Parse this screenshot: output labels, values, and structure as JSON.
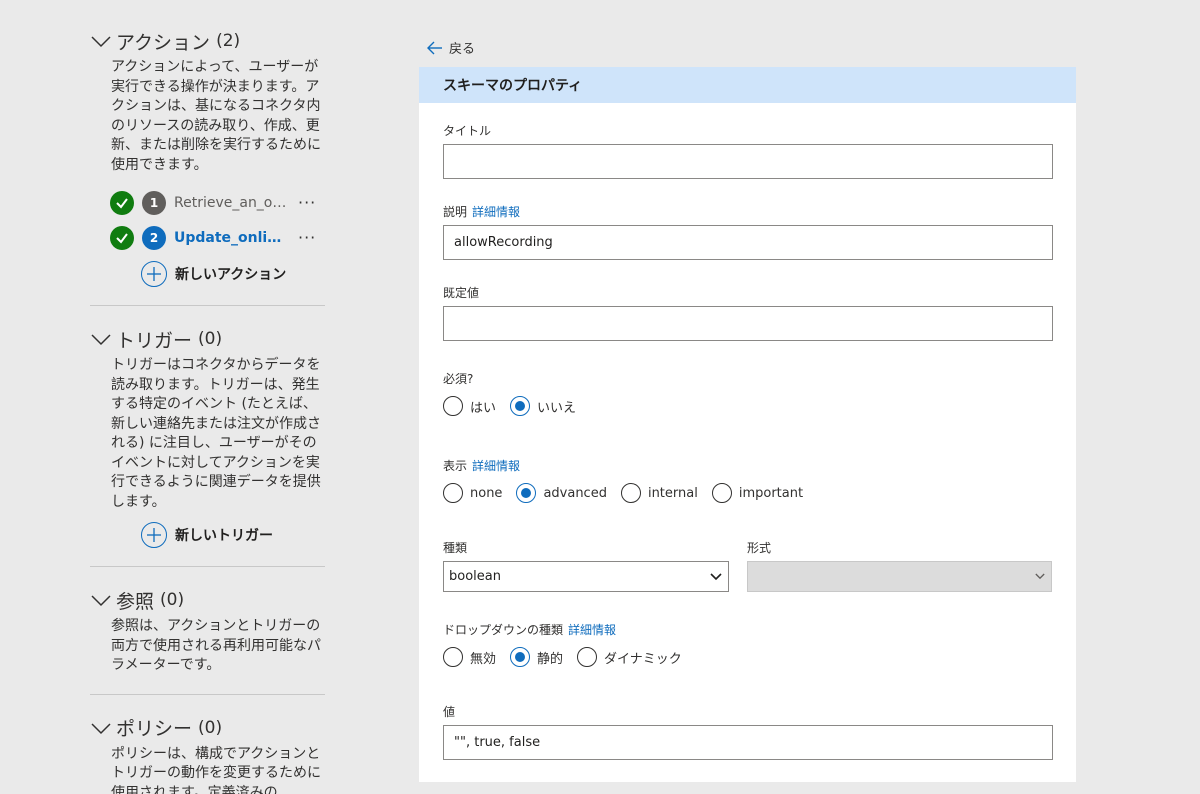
{
  "sidebar": {
    "sections": [
      {
        "title": "アクション",
        "count": "(2)",
        "description": "アクションによって、ユーザーが実行できる操作が決まります。アクションは、基になるコネクタ内のリソースの読み取り、作成、更新、または削除を実行するために使用できます。",
        "new_label": "新しいアクション"
      },
      {
        "title": "トリガー",
        "count": "(0)",
        "description": "トリガーはコネクタからデータを読み取ります。トリガーは、発生する特定のイベント (たとえば、新しい連絡先または注文が作成される) に注目し、ユーザーがそのイベントに対してアクションを実行できるように関連データを提供します。",
        "new_label": "新しいトリガー"
      },
      {
        "title": "参照",
        "count": "(0)",
        "description": "参照は、アクションとトリガーの両方で使用される再利用可能なパラメーターです。"
      },
      {
        "title": "ポリシー",
        "count": "(0)",
        "description": "ポリシーは、構成でアクションとトリガーの動作を変更するために使用されます。定義済みの"
      }
    ],
    "actions": [
      {
        "number": "1",
        "name": "Retrieve_an_onl...",
        "more": "···"
      },
      {
        "number": "2",
        "name": "Update_onlin...",
        "more": "···"
      }
    ]
  },
  "back_label": "戻る",
  "panel": {
    "title": "スキーマのプロパティ",
    "title_field": {
      "label": "タイトル",
      "value": ""
    },
    "description_field": {
      "label": "説明",
      "link": "詳細情報",
      "value": "allowRecording"
    },
    "default_field": {
      "label": "既定値",
      "value": ""
    },
    "required": {
      "label": "必須?",
      "options": [
        "はい",
        "いいえ"
      ],
      "selected": "いいえ"
    },
    "visibility": {
      "label": "表示",
      "link": "詳細情報",
      "options": [
        "none",
        "advanced",
        "internal",
        "important"
      ],
      "selected": "advanced"
    },
    "type": {
      "label": "種類",
      "value": "boolean"
    },
    "format": {
      "label": "形式",
      "value": ""
    },
    "dropdown_type": {
      "label": "ドロップダウンの種類",
      "link": "詳細情報",
      "options": [
        "無効",
        "静的",
        "ダイナミック"
      ],
      "selected": "静的"
    },
    "values": {
      "label": "値",
      "value": "\"\", true, false"
    }
  },
  "colors": {
    "accent": "#0f6cbd",
    "success": "#107c10",
    "header_bg": "#cfe4fa",
    "page_bg": "#eaeaea"
  }
}
